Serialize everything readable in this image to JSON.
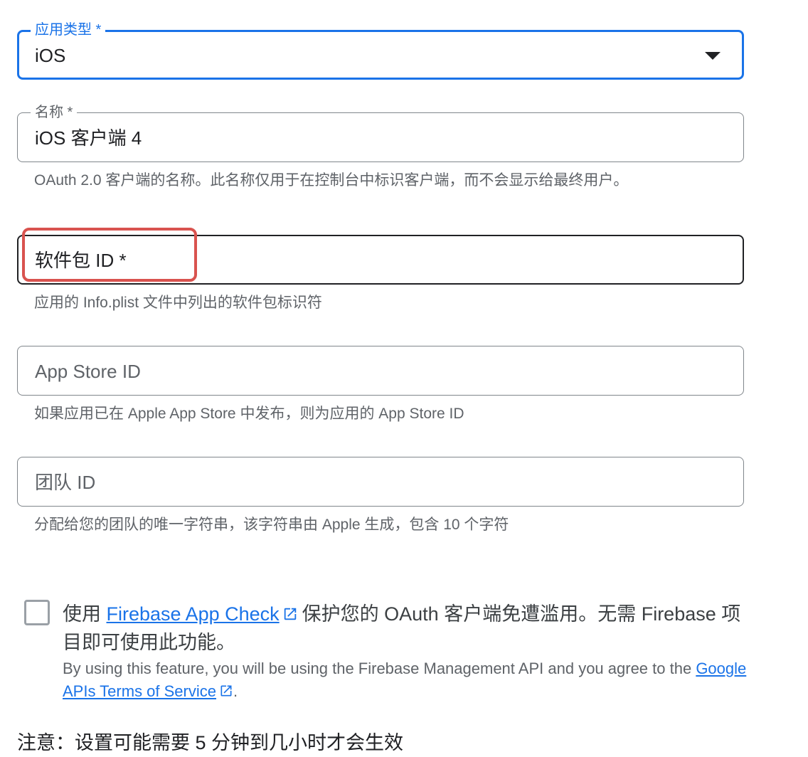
{
  "app_type": {
    "label": "应用类型 *",
    "value": "iOS"
  },
  "name": {
    "label": "名称 *",
    "value": "iOS 客户端 4",
    "hint": "OAuth 2.0 客户端的名称。此名称仅用于在控制台中标识客户端，而不会显示给最终用户。"
  },
  "bundle_id": {
    "placeholder": "软件包 ID *",
    "hint": "应用的 Info.plist 文件中列出的软件包标识符"
  },
  "app_store_id": {
    "placeholder": "App Store ID",
    "hint": "如果应用已在 Apple App Store 中发布，则为应用的 App Store ID"
  },
  "team_id": {
    "placeholder": "团队 ID",
    "hint": "分配给您的团队的唯一字符串，该字符串由 Apple 生成，包含 10 个字符"
  },
  "app_check": {
    "prefix": "使用 ",
    "link": "Firebase App Check",
    "suffix": "保护您的 OAuth 客户端免遭滥用。无需 Firebase 项目即可使用此功能。",
    "sub_text": "By using this feature, you will be using the Firebase Management API and you agree to the ",
    "terms_link": "Google APIs Terms of Service",
    "sub_end": "."
  },
  "note": "注意：设置可能需要 5 分钟到几小时才会生效",
  "colors": {
    "accent": "#1a73e8",
    "highlight": "#d9534f"
  }
}
